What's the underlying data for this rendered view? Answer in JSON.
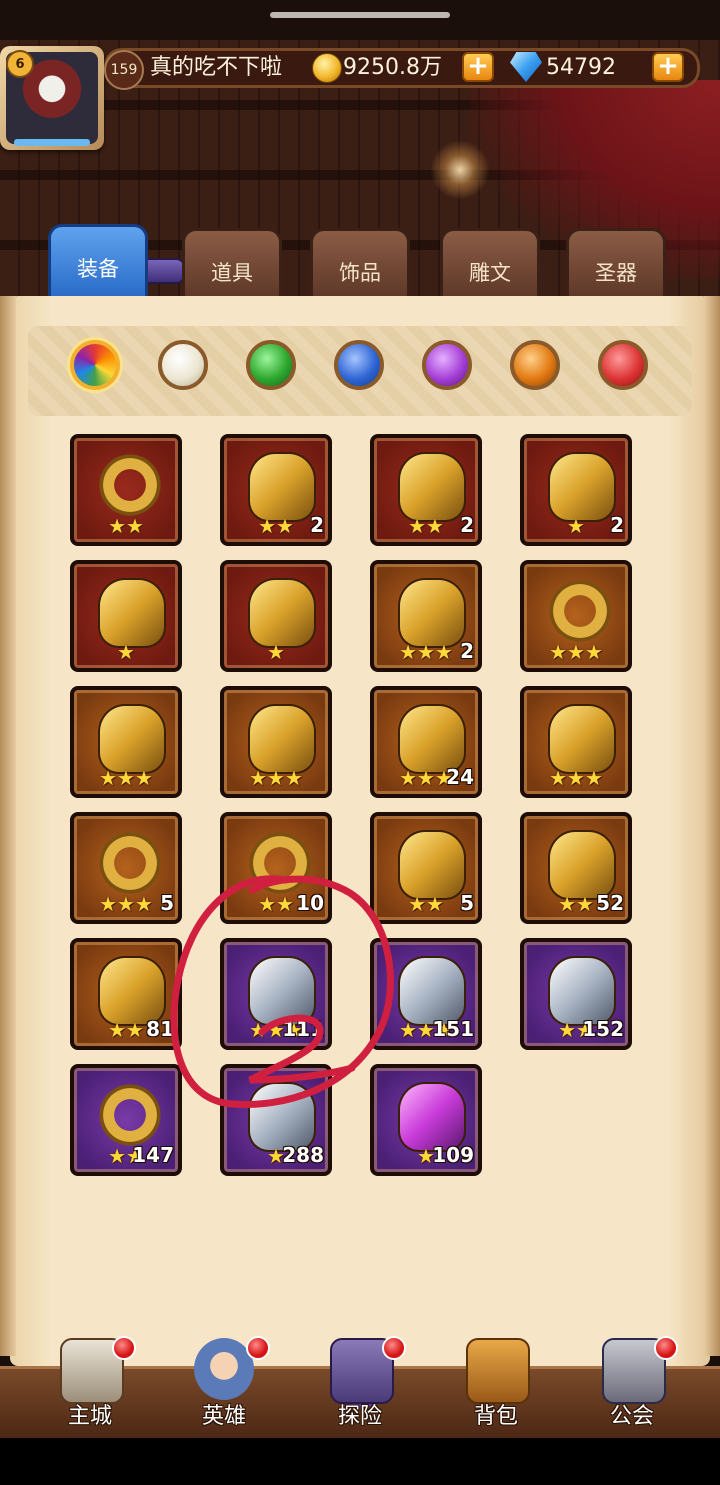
{
  "header": {
    "vip_level": "6",
    "player_level": "159",
    "player_name": "真的吃不下啦",
    "gold": "9250.8万",
    "gems": "54792",
    "plus_label": "+"
  },
  "tabs": [
    {
      "label": "装备",
      "active": true
    },
    {
      "label": "道具",
      "active": false
    },
    {
      "label": "饰品",
      "active": false
    },
    {
      "label": "雕文",
      "active": false
    },
    {
      "label": "圣器",
      "active": false
    }
  ],
  "color_filters": [
    {
      "name": "all",
      "color": "rainbow",
      "active": true
    },
    {
      "name": "white",
      "color": "#ece6d2"
    },
    {
      "name": "green",
      "color": "#2ea82e"
    },
    {
      "name": "blue",
      "color": "#2f66d4"
    },
    {
      "name": "purple",
      "color": "#a53fd6"
    },
    {
      "name": "orange",
      "color": "#e27a12"
    },
    {
      "name": "red",
      "color": "#dc3434"
    }
  ],
  "items": [
    {
      "icon": "ring",
      "rarity": "red",
      "stars": "★★",
      "count": ""
    },
    {
      "icon": "helmet",
      "rarity": "red",
      "stars": "★★",
      "count": "2"
    },
    {
      "icon": "axe",
      "rarity": "red",
      "stars": "★★",
      "count": "2"
    },
    {
      "icon": "helmet",
      "rarity": "red",
      "stars": "★",
      "count": "2"
    },
    {
      "icon": "armor",
      "rarity": "red",
      "stars": "★",
      "count": ""
    },
    {
      "icon": "mace",
      "rarity": "red",
      "stars": "★",
      "count": ""
    },
    {
      "icon": "helmet",
      "rarity": "orange",
      "stars": "★★★",
      "count": "2"
    },
    {
      "icon": "ring",
      "rarity": "orange",
      "stars": "★★★",
      "count": ""
    },
    {
      "icon": "armor",
      "rarity": "orange",
      "stars": "★★★",
      "count": ""
    },
    {
      "icon": "hammer",
      "rarity": "orange",
      "stars": "★★★",
      "count": ""
    },
    {
      "icon": "helmet",
      "rarity": "orange",
      "stars": "★★★",
      "count": "24"
    },
    {
      "icon": "armor",
      "rarity": "orange",
      "stars": "★★★",
      "count": ""
    },
    {
      "icon": "ring",
      "rarity": "orange",
      "stars": "★★★",
      "count": "5"
    },
    {
      "icon": "ring",
      "rarity": "orange",
      "stars": "★★",
      "count": "10"
    },
    {
      "icon": "armor",
      "rarity": "orange",
      "stars": "★★",
      "count": "5"
    },
    {
      "icon": "sword",
      "rarity": "orange",
      "stars": "★★",
      "count": "52"
    },
    {
      "icon": "helmet",
      "rarity": "orange",
      "stars": "★★",
      "count": "81"
    },
    {
      "icon": "helmet",
      "rarity": "purple",
      "stars": "★★★",
      "count": "111"
    },
    {
      "icon": "armor",
      "rarity": "purple",
      "stars": "★★★",
      "count": "151"
    },
    {
      "icon": "sword",
      "rarity": "purple",
      "stars": "★★",
      "count": "152"
    },
    {
      "icon": "ring",
      "rarity": "purple",
      "stars": "★★",
      "count": "147"
    },
    {
      "icon": "helmet",
      "rarity": "purple",
      "stars": "★",
      "count": "288"
    },
    {
      "icon": "armor",
      "rarity": "purple",
      "stars": "★",
      "count": "109"
    }
  ],
  "nav": [
    {
      "label": "主城",
      "badge": true
    },
    {
      "label": "英雄",
      "badge": true
    },
    {
      "label": "探险",
      "badge": true
    },
    {
      "label": "背包",
      "badge": false
    },
    {
      "label": "公会",
      "badge": true
    }
  ],
  "annotation_color": "#d11f3f"
}
